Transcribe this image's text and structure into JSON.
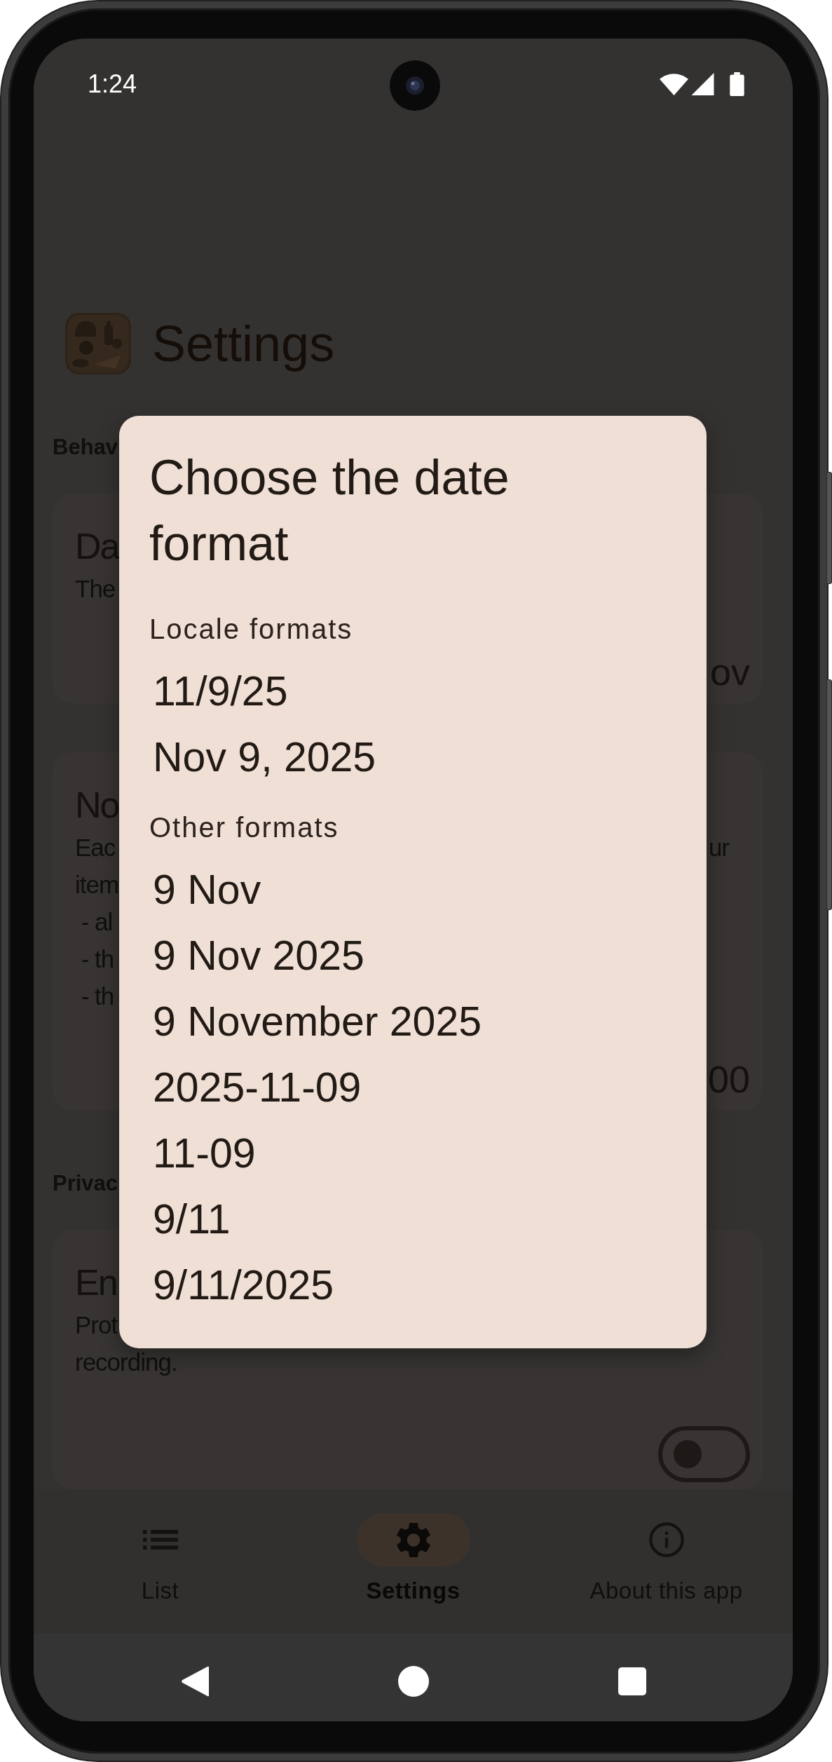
{
  "status_bar": {
    "time": "1:24"
  },
  "app_bar": {
    "title": "Settings"
  },
  "sections": [
    {
      "header": "Behav",
      "cards": [
        {
          "kind": "value",
          "title": "Da",
          "description": [
            {
              "text": "The"
            }
          ],
          "value": "ov"
        },
        {
          "kind": "value",
          "title": "No",
          "description": [
            {
              "text": "Eac",
              "trailing": "ur"
            },
            {
              "text": "item"
            },
            {
              "text": " - al"
            },
            {
              "text": " - th"
            },
            {
              "text": " - th"
            }
          ],
          "value": "00"
        }
      ]
    },
    {
      "header": "Privac",
      "cards": [
        {
          "kind": "switch",
          "title": "En",
          "description": [
            {
              "text": "Prot"
            },
            {
              "text": "recording."
            }
          ],
          "on": false
        }
      ]
    }
  ],
  "nav_items": [
    {
      "label": "List",
      "selected": false
    },
    {
      "label": "Settings",
      "selected": true
    },
    {
      "label": "About this app",
      "selected": false
    }
  ],
  "dialog": {
    "title": "Choose the date format",
    "groups": [
      {
        "header": "Locale formats",
        "options": [
          "11/9/25",
          "Nov 9, 2025"
        ]
      },
      {
        "header": "Other formats",
        "options": [
          "9 Nov",
          "9 Nov 2025",
          "9 November 2025",
          "2025-11-09",
          "11-09",
          "9/11",
          "9/11/2025"
        ]
      }
    ]
  }
}
